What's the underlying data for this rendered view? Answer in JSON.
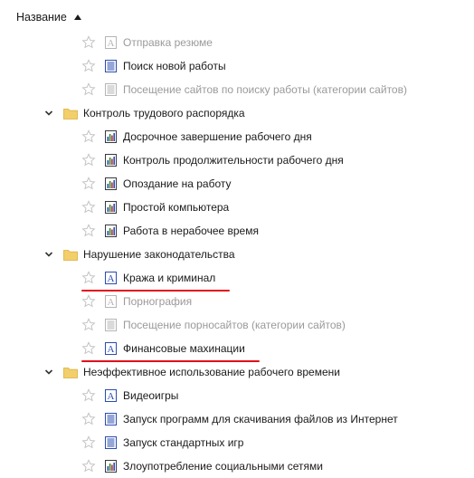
{
  "header": {
    "column_title": "Название",
    "sort": "ascending"
  },
  "colors": {
    "accent_blue": "#2a4cb0",
    "folder_yellow": "#f2cf6a",
    "annotation_red": "#e0101a",
    "disabled_gray": "#9a9a9a"
  },
  "rows": [
    {
      "type": "item",
      "label": "Отправка резюме",
      "icon": "text-icon",
      "disabled": true
    },
    {
      "type": "item",
      "label": "Поиск новой работы",
      "icon": "list-icon",
      "disabled": false
    },
    {
      "type": "item",
      "label": "Посещение сайтов по поиску работы (категории сайтов)",
      "icon": "list-icon",
      "disabled": true
    },
    {
      "type": "folder",
      "label": "Контроль трудового распорядка",
      "expanded": true
    },
    {
      "type": "item",
      "label": "Досрочное завершение рабочего дня",
      "icon": "bar-chart-icon",
      "disabled": false
    },
    {
      "type": "item",
      "label": "Контроль продолжительности рабочего дня",
      "icon": "bar-chart-icon",
      "disabled": false
    },
    {
      "type": "item",
      "label": "Опоздание на работу",
      "icon": "bar-chart-icon",
      "disabled": false
    },
    {
      "type": "item",
      "label": "Простой компьютера",
      "icon": "bar-chart-icon",
      "disabled": false
    },
    {
      "type": "item",
      "label": "Работа в нерабочее время",
      "icon": "bar-chart-icon",
      "disabled": false
    },
    {
      "type": "folder",
      "label": "Нарушение законодательства",
      "expanded": true
    },
    {
      "type": "item",
      "label": "Кража и криминал",
      "icon": "text-icon",
      "disabled": false,
      "highlighted": true
    },
    {
      "type": "item",
      "label": "Порнография",
      "icon": "text-icon",
      "disabled": true
    },
    {
      "type": "item",
      "label": "Посещение порносайтов (категории сайтов)",
      "icon": "list-icon",
      "disabled": true
    },
    {
      "type": "item",
      "label": "Финансовые махинации",
      "icon": "text-icon",
      "disabled": false,
      "highlighted": true
    },
    {
      "type": "folder",
      "label": "Неэффективное использование рабочего времени",
      "expanded": true
    },
    {
      "type": "item",
      "label": "Видеоигры",
      "icon": "text-icon",
      "disabled": false
    },
    {
      "type": "item",
      "label": "Запуск программ для скачивания файлов из Интернет",
      "icon": "list-icon",
      "disabled": false
    },
    {
      "type": "item",
      "label": "Запуск стандартных игр",
      "icon": "list-icon",
      "disabled": false
    },
    {
      "type": "item",
      "label": "Злоупотребление социальными сетями",
      "icon": "bar-chart-icon",
      "disabled": false
    }
  ]
}
